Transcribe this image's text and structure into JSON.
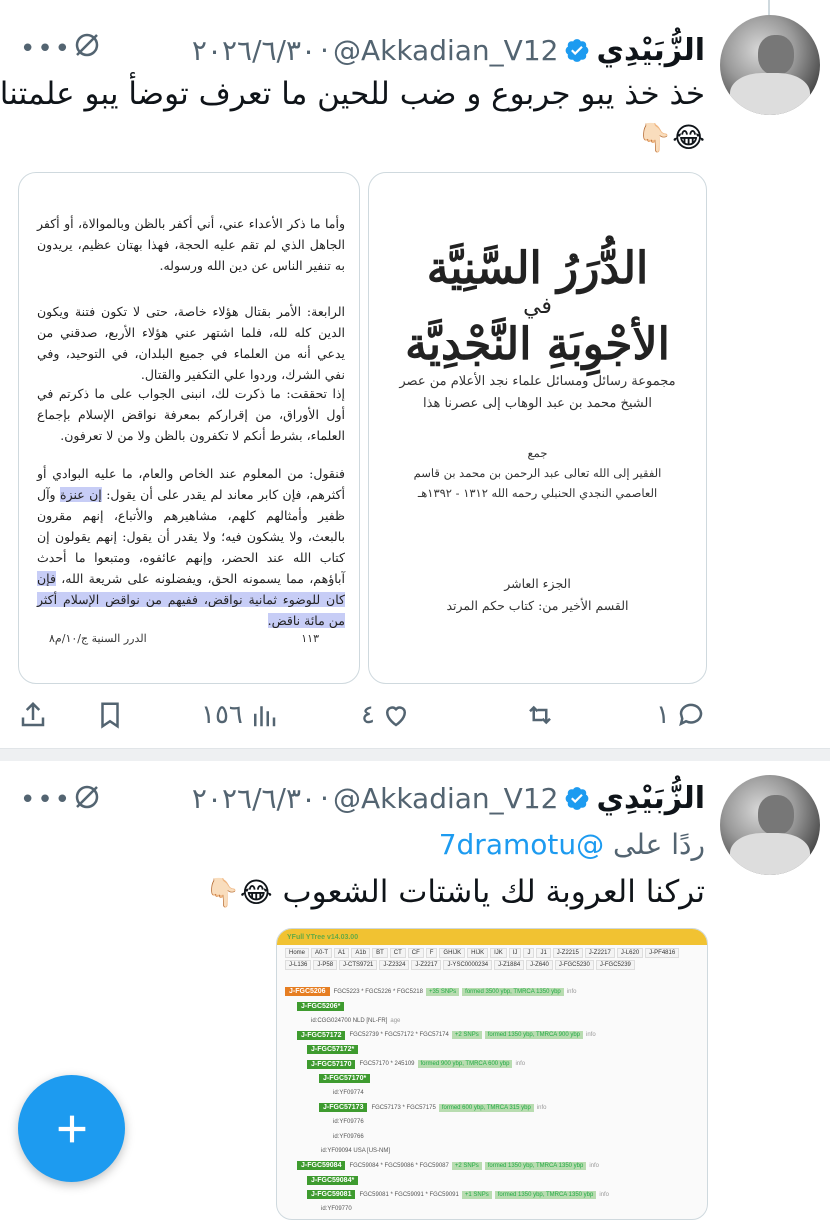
{
  "tweet1": {
    "display_name": "الزُّبَيْدِي",
    "handle": "@Akkadian_V12",
    "date": "٢٠٢٦/٦/٣٠",
    "separator": "·",
    "text": "خذ خذ يبو جربوع و ضب للحين ما تعرف توضأ يبو علمتنا",
    "emojis": "😂👇🏻",
    "left_page": {
      "p1": "وأما ما ذكر الأعداء عني، أني أكفر بالظن وبالموالاة، أو أكفر الجاهل الذي لم تقم عليه الحجة، فهذا بهتان عظيم، يريدون به تنفير الناس عن دين الله ورسوله.",
      "p2": "الرابعة: الأمر بقتال هؤلاء خاصة، حتى لا تكون فتنة ويكون الدين كله لله، فلما اشتهر عني هؤلاء الأربع، صدقني من يدعي أنه من العلماء في جميع البلدان، في التوحيد، وفي نفي الشرك، وردوا علي التكفير والقتال.",
      "p3": "إذا تحققت: ما ذكرت لك، انبنى الجواب على ما ذكرتم في أول الأوراق، من إقراركم بمعرفة نواقض الإسلام بإجماع العلماء، بشرط أنكم لا تكفرون بالظن ولا من لا تعرفون.",
      "p4_a": "فنقول: من المعلوم عند الخاص والعام، ما عليه البوادي أو أكثرهم، فإن كابر معاند لم يقدر على أن يقول:",
      "p4_hl1": "إن عنزة",
      "p4_b": "وآل ظفير وأمثالهم كلهم، مشاهيرهم والأتباع، إنهم مقرون بالبعث، ولا يشكون فيه؛ ولا يقدر أن يقول: إنهم يقولون إن كتاب الله عند الحضر، وإنهم عائفوه، ومتبعوا ما أحدث آباؤهم، مما يسمونه الحق، ويفضلونه على شريعة الله،",
      "p4_hl2": "فإن كان للوضوء ثمانية نواقض، ففيهم من نواقض الإسلام أكثر من مائة ناقض.",
      "page_number": "١١٣",
      "footer": "الدرر السنية ج/١٠/م٨"
    },
    "right_page": {
      "title_line1": "الدُّرَرُ السَّنِيَّة",
      "title_line2": "في",
      "title_line3": "الأجْوِبَةِ النَّجْدِيَّة",
      "subtitle": "مجموعة رسائل ومسائل علماء نجد الأعلام من عصر الشيخ محمد بن عبد الوهاب إلى عصرنا هذا",
      "compiled": "جمع",
      "compiler": "الفقير إلى الله تعالى عبد الرحمن بن محمد بن قاسم العاصمي النجدي الحنبلي رحمه الله ١٣١٢ - ١٣٩٢هـ",
      "volume": "الجزء العاشر",
      "section": "القسم الأخير من: كتاب حكم المرتد"
    },
    "actions": {
      "replies": "١",
      "likes": "٤",
      "views": "١٥٦"
    }
  },
  "tweet2": {
    "display_name": "الزُّبَيْدِي",
    "handle": "@Akkadian_V12",
    "date": "٢٠٢٦/٦/٣٠",
    "separator": "·",
    "reply_prefix": "ردًا على",
    "reply_handle": "@7dramotu",
    "text": "تركنا العروبة لك ياشتات الشعوب",
    "emojis": "😂👇🏻",
    "ytree": {
      "title": "YFull YTree v14.03.00",
      "nav_items": [
        "Home",
        "A0-T",
        "A1",
        "A1b",
        "BT",
        "CT",
        "CF",
        "F",
        "GHIJK",
        "HIJK",
        "IJK",
        "IJ",
        "J",
        "J1",
        "J-Z2215",
        "J-Z2217",
        "J-L620",
        "J-PF4816",
        "J-L136",
        "J-P58",
        "J-CTS9721",
        "J-Z2324",
        "J-Z2217",
        "J-YSC0000234",
        "J-Z1884",
        "J-Z640",
        "J-FGC5230",
        "J-FGC5239"
      ],
      "rows": [
        {
          "node": "J-FGC5206",
          "snps": "FGC5223 * FGC5226 * FGC5218",
          "pill": "+35 SNPs",
          "formed": "formed 3500 ybp, TMRCA 1350 ybp",
          "info": "info"
        },
        {
          "node": "J-FGC5206*",
          "snps": "",
          "pill": "",
          "formed": "",
          "info": ""
        },
        {
          "node": "",
          "snps": "id:CGG024700 NLD [NL-FR]",
          "pill": "",
          "formed": "",
          "info": "age"
        },
        {
          "node": "J-FGC57172",
          "snps": "FGC52739 * FGC57172 * FGC57174",
          "pill": "+2 SNPs",
          "formed": "formed 1350 ybp, TMRCA 900 ybp",
          "info": "info"
        },
        {
          "node": "J-FGC57172*",
          "snps": "",
          "pill": "",
          "formed": "",
          "info": ""
        },
        {
          "node": "J-FGC57170",
          "snps": "FGC57170 * 245109",
          "pill": "",
          "formed": "formed 900 ybp, TMRCA 600 ybp",
          "info": "info"
        },
        {
          "node": "J-FGC57170*",
          "snps": "",
          "pill": "",
          "formed": "",
          "info": ""
        },
        {
          "node": "",
          "snps": "id:YF09774",
          "pill": "",
          "formed": "",
          "info": ""
        },
        {
          "node": "J-FGC57173",
          "snps": "FGC57173 * FGC57175",
          "pill": "",
          "formed": "formed 600 ybp, TMRCA 315 ybp",
          "info": "info"
        },
        {
          "node": "",
          "snps": "id:YF09776",
          "pill": "",
          "formed": "",
          "info": ""
        },
        {
          "node": "",
          "snps": "id:YF09766",
          "pill": "",
          "formed": "",
          "info": ""
        },
        {
          "node": "",
          "snps": "id:YF09094 USA [US-NM]",
          "pill": "",
          "formed": "",
          "info": ""
        },
        {
          "node": "J-FGC59084",
          "snps": "FGC59084 * FGC59086 * FGC59087",
          "pill": "+2 SNPs",
          "formed": "formed 1350 ybp, TMRCA 1350 ybp",
          "info": "info"
        },
        {
          "node": "J-FGC59084*",
          "snps": "",
          "pill": "",
          "formed": "",
          "info": ""
        },
        {
          "node": "J-FGC59081",
          "snps": "FGC59081 * FGC59091 * FGC59091",
          "pill": "+1 SNPs",
          "formed": "formed 1350 ybp, TMRCA 1350 ybp",
          "info": "info"
        },
        {
          "node": "",
          "snps": "id:YF09770",
          "pill": "",
          "formed": "",
          "info": ""
        }
      ]
    }
  },
  "colors": {
    "accent": "#1d9bf0",
    "text": "#0f1419",
    "muted": "#536471",
    "highlight": "#c7cdf6",
    "ytree_bar": "#f1c232",
    "ytree_node": "#3e9b2f"
  },
  "icons": [
    "verified-badge-icon",
    "mute-icon",
    "more-icon",
    "share-icon",
    "bookmark-icon",
    "views-icon",
    "like-icon",
    "retweet-icon",
    "reply-icon",
    "compose-icon"
  ]
}
